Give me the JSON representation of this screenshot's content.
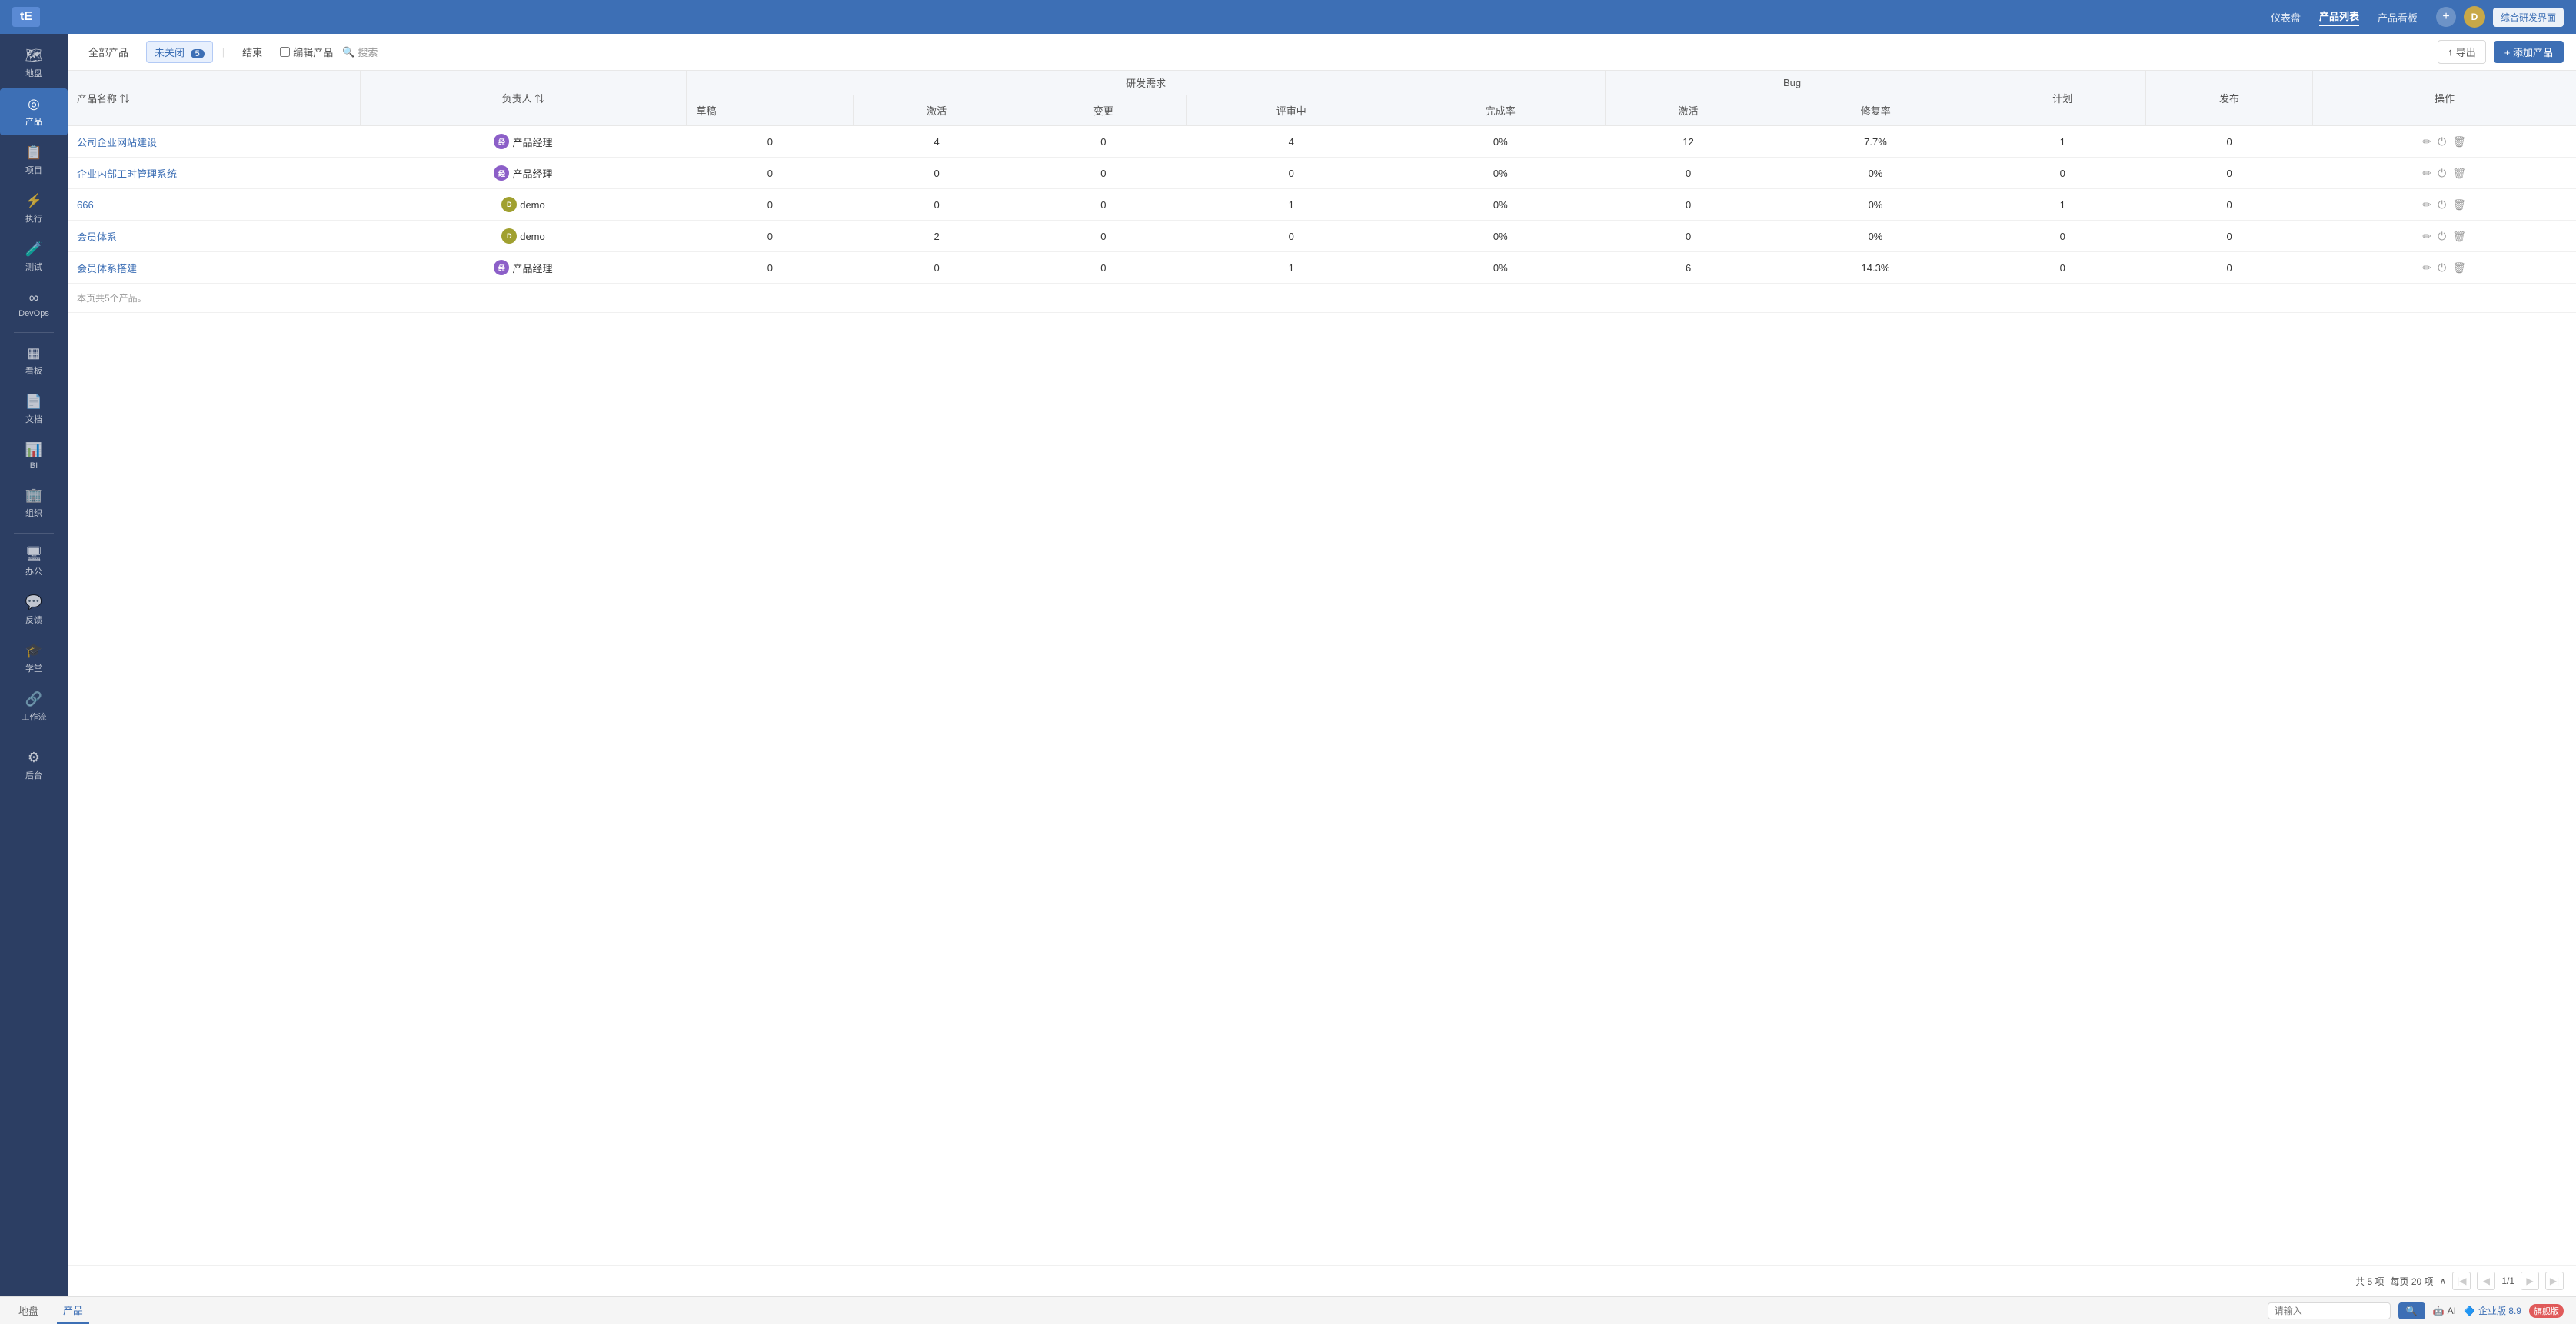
{
  "app": {
    "logo_text": "tE",
    "title": "产品"
  },
  "top_nav": {
    "items": [
      {
        "label": "仪表盘",
        "active": false
      },
      {
        "label": "产品列表",
        "active": true
      },
      {
        "label": "产品看板",
        "active": false
      }
    ],
    "add_icon": "+",
    "avatar_label": "D",
    "research_btn": "综合研发界面"
  },
  "sidebar": {
    "items": [
      {
        "icon": "🗺",
        "label": "地盘"
      },
      {
        "icon": "◎",
        "label": "产品",
        "active": true
      },
      {
        "icon": "📋",
        "label": "项目"
      },
      {
        "icon": "⚡",
        "label": "执行"
      },
      {
        "icon": "🧪",
        "label": "测试"
      },
      {
        "icon": "∞",
        "label": "DevOps"
      },
      {
        "divider": true
      },
      {
        "icon": "▦",
        "label": "看板"
      },
      {
        "icon": "📄",
        "label": "文档"
      },
      {
        "icon": "📊",
        "label": "BI"
      },
      {
        "icon": "🏢",
        "label": "组织"
      },
      {
        "divider": true
      },
      {
        "icon": "🖥",
        "label": "办公"
      },
      {
        "icon": "💬",
        "label": "反馈"
      },
      {
        "icon": "🎓",
        "label": "学堂"
      },
      {
        "icon": "🔗",
        "label": "工作流"
      },
      {
        "divider": true
      },
      {
        "icon": "⚙",
        "label": "后台"
      }
    ]
  },
  "toolbar": {
    "all_products": "全部产品",
    "unclosed": "未关闭",
    "unclosed_count": "5",
    "ended": "结束",
    "edit_products": "编辑产品",
    "search": "搜索",
    "export": "导出",
    "add_product": "+ 添加产品"
  },
  "table": {
    "columns": {
      "product_name": "产品名称",
      "assignee": "负责人",
      "research_group": "研发需求",
      "bug_group": "Bug",
      "plan": "计划",
      "release": "发布",
      "action": "操作"
    },
    "sub_columns": {
      "draft": "草稿",
      "active": "激活",
      "change": "变更",
      "review": "评审中",
      "completion": "完成率",
      "bug_active": "激活",
      "fix_rate": "修复率"
    },
    "rows": [
      {
        "name": "公司企业网站建设",
        "assignee_avatar": "经理",
        "assignee_label": "产品经理",
        "avatar_type": "purple",
        "draft": "0",
        "active": "4",
        "change": "0",
        "review": "4",
        "completion": "0%",
        "bug_active": "12",
        "fix_rate": "7.7%",
        "plan": "1",
        "release": "0"
      },
      {
        "name": "企业内部工时管理系统",
        "assignee_avatar": "经理",
        "assignee_label": "产品经理",
        "avatar_type": "purple",
        "draft": "0",
        "active": "0",
        "change": "0",
        "review": "0",
        "completion": "0%",
        "bug_active": "0",
        "fix_rate": "0%",
        "plan": "0",
        "release": "0"
      },
      {
        "name": "666",
        "assignee_avatar": "D",
        "assignee_label": "demo",
        "avatar_type": "olive",
        "draft": "0",
        "active": "0",
        "change": "0",
        "review": "1",
        "completion": "0%",
        "bug_active": "0",
        "fix_rate": "0%",
        "plan": "1",
        "release": "0"
      },
      {
        "name": "会员体系",
        "assignee_avatar": "D",
        "assignee_label": "demo",
        "avatar_type": "olive",
        "draft": "0",
        "active": "2",
        "change": "0",
        "review": "0",
        "completion": "0%",
        "bug_active": "0",
        "fix_rate": "0%",
        "plan": "0",
        "release": "0"
      },
      {
        "name": "会员体系搭建",
        "assignee_avatar": "经理",
        "assignee_label": "产品经理",
        "avatar_type": "purple",
        "draft": "0",
        "active": "0",
        "change": "0",
        "review": "1",
        "completion": "0%",
        "bug_active": "6",
        "fix_rate": "14.3%",
        "plan": "0",
        "release": "0"
      }
    ],
    "footer_text": "本页共5个产品。",
    "pagination": {
      "total": "共 5 项",
      "per_page": "每页 20 项",
      "current_page": "1/1"
    }
  },
  "bottom_bar": {
    "tabs": [
      {
        "label": "地盘"
      },
      {
        "label": "产品",
        "active": true
      }
    ],
    "input_placeholder": "请输入",
    "search_btn": "🔍",
    "ai_label": "AI",
    "enterprise_label": "企业版 8.9",
    "flagship_badge": "旗舰版"
  }
}
